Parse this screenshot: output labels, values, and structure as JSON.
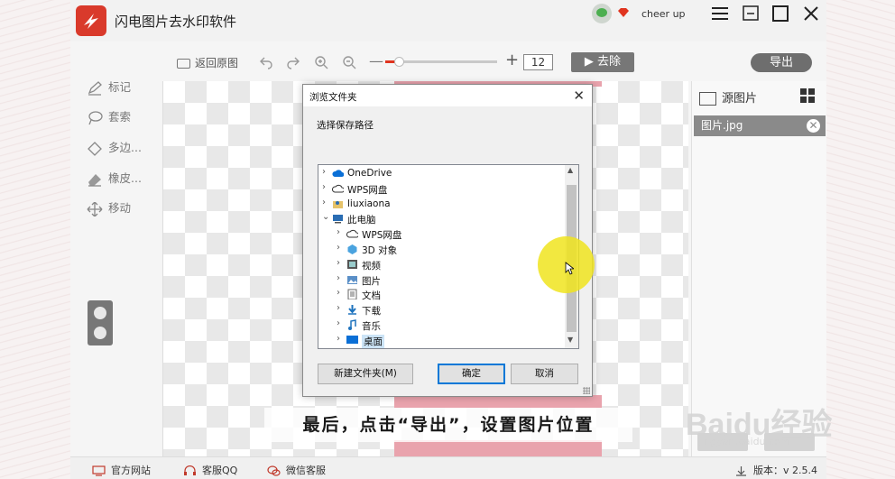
{
  "app": {
    "title": "闪电图片去水印软件",
    "username": "cheer up"
  },
  "toolbar": {
    "restore_label": "返回原图",
    "zoom_value": "12",
    "zoom_level_fraction": 0.12,
    "remove_label": "▶ 去除",
    "export_label": "导出"
  },
  "tools": [
    {
      "label": "标记",
      "icon": "pen-icon"
    },
    {
      "label": "套索",
      "icon": "lasso-icon"
    },
    {
      "label": "多边...",
      "icon": "polygon-icon"
    },
    {
      "label": "橡皮...",
      "icon": "eraser-icon"
    },
    {
      "label": "移动",
      "icon": "move-icon"
    }
  ],
  "right_panel": {
    "header": "源图片",
    "file_name": "图片.jpg"
  },
  "status_bar": {
    "website": "官方网站",
    "qq": "客服QQ",
    "wechat": "微信客服",
    "version": "版本：v 2.5.4"
  },
  "dialog": {
    "title": "浏览文件夹",
    "prompt": "选择保存路径",
    "tree": [
      {
        "label": "OneDrive",
        "icon": "cloud-icon",
        "level": 0,
        "expanded": false
      },
      {
        "label": "WPS网盘",
        "icon": "cloud-outline-icon",
        "level": 0,
        "expanded": false
      },
      {
        "label": "liuxiaona",
        "icon": "user-folder-icon",
        "level": 0,
        "expanded": false
      },
      {
        "label": "此电脑",
        "icon": "computer-icon",
        "level": 0,
        "expanded": true
      },
      {
        "label": "WPS网盘",
        "icon": "cloud-outline-icon",
        "level": 1,
        "expanded": false
      },
      {
        "label": "3D 对象",
        "icon": "cube-icon",
        "level": 1,
        "expanded": false
      },
      {
        "label": "视频",
        "icon": "film-icon",
        "level": 1,
        "expanded": false
      },
      {
        "label": "图片",
        "icon": "picture-icon",
        "level": 1,
        "expanded": false
      },
      {
        "label": "文档",
        "icon": "document-icon",
        "level": 1,
        "expanded": false
      },
      {
        "label": "下载",
        "icon": "download-icon",
        "level": 1,
        "expanded": false
      },
      {
        "label": "音乐",
        "icon": "music-icon",
        "level": 1,
        "expanded": false
      },
      {
        "label": "桌面",
        "icon": "desktop-icon",
        "level": 1,
        "expanded": false,
        "selected": true
      }
    ],
    "new_folder_label": "新建文件夹(M)",
    "ok_label": "确定",
    "cancel_label": "取消"
  },
  "caption": "最后，点击“导出”，设置图片位置",
  "watermark": {
    "main": "Baidu经验",
    "sub": "jingyan.baidu.com"
  },
  "colors": {
    "logo_red": "#d93a2b",
    "accent_pink": "#e9a3ad",
    "highlight_yellow": "#f0e41e",
    "selection_blue": "#cce4f7"
  }
}
